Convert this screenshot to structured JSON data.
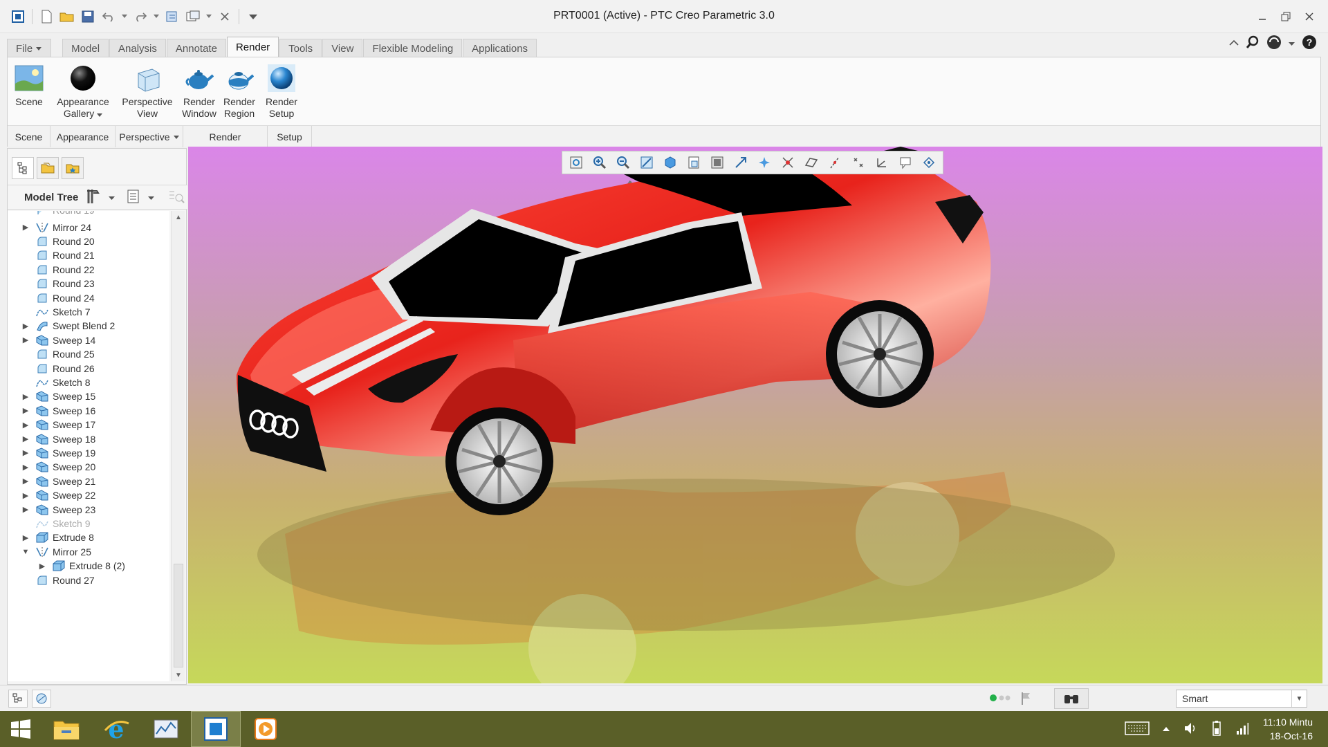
{
  "window": {
    "title": "PRT0001 (Active) - PTC Creo Parametric 3.0"
  },
  "tabs": [
    {
      "label": "File",
      "name": "tab-file"
    },
    {
      "label": "Model",
      "name": "tab-model"
    },
    {
      "label": "Analysis",
      "name": "tab-analysis"
    },
    {
      "label": "Annotate",
      "name": "tab-annotate"
    },
    {
      "label": "Render",
      "name": "tab-render",
      "active": true
    },
    {
      "label": "Tools",
      "name": "tab-tools"
    },
    {
      "label": "View",
      "name": "tab-view"
    },
    {
      "label": "Flexible Modeling",
      "name": "tab-flexible-modeling"
    },
    {
      "label": "Applications",
      "name": "tab-applications"
    }
  ],
  "ribbon": {
    "buttons": {
      "scene": "Scene",
      "appearance_1": "Appearance",
      "appearance_2": "Gallery",
      "perspective_1": "Perspective",
      "perspective_2": "View",
      "render_window_1": "Render",
      "render_window_2": "Window",
      "render_region_1": "Render",
      "render_region_2": "Region",
      "render_setup_1": "Render",
      "render_setup_2": "Setup"
    },
    "groups": {
      "scene": "Scene",
      "appearance": "Appearance",
      "perspective": "Perspective",
      "render": "Render",
      "setup": "Setup"
    }
  },
  "model_tree": {
    "label": "Model Tree",
    "items": [
      {
        "label": "Mirror 24",
        "icon": "mirror-icon",
        "expandable": true
      },
      {
        "label": "Round 20",
        "icon": "round-icon",
        "expandable": false
      },
      {
        "label": "Round 21",
        "icon": "round-icon",
        "expandable": false
      },
      {
        "label": "Round 22",
        "icon": "round-icon",
        "expandable": false
      },
      {
        "label": "Round 23",
        "icon": "round-icon",
        "expandable": false
      },
      {
        "label": "Round 24",
        "icon": "round-icon",
        "expandable": false
      },
      {
        "label": "Sketch 7",
        "icon": "sketch-icon",
        "expandable": false
      },
      {
        "label": "Swept Blend 2",
        "icon": "swept-blend-icon",
        "expandable": true
      },
      {
        "label": "Sweep 14",
        "icon": "sweep-icon",
        "expandable": true
      },
      {
        "label": "Round 25",
        "icon": "round-icon",
        "expandable": false
      },
      {
        "label": "Round 26",
        "icon": "round-icon",
        "expandable": false
      },
      {
        "label": "Sketch 8",
        "icon": "sketch-icon",
        "expandable": false
      },
      {
        "label": "Sweep 15",
        "icon": "sweep-icon",
        "expandable": true
      },
      {
        "label": "Sweep 16",
        "icon": "sweep-icon",
        "expandable": true
      },
      {
        "label": "Sweep 17",
        "icon": "sweep-icon",
        "expandable": true
      },
      {
        "label": "Sweep 18",
        "icon": "sweep-icon",
        "expandable": true
      },
      {
        "label": "Sweep 19",
        "icon": "sweep-icon",
        "expandable": true
      },
      {
        "label": "Sweep 20",
        "icon": "sweep-icon",
        "expandable": true
      },
      {
        "label": "Sweep 21",
        "icon": "sweep-icon",
        "expandable": true
      },
      {
        "label": "Sweep 22",
        "icon": "sweep-icon",
        "expandable": true
      },
      {
        "label": "Sweep 23",
        "icon": "sweep-icon",
        "expandable": true
      },
      {
        "label": "Sketch 9",
        "icon": "sketch-icon",
        "expandable": false,
        "dim": true
      },
      {
        "label": "Extrude 8",
        "icon": "extrude-icon",
        "expandable": true
      },
      {
        "label": "Mirror 25",
        "icon": "mirror-icon",
        "expandable": true,
        "expanded": true
      },
      {
        "label": "Extrude 8 (2)",
        "icon": "extrude-icon",
        "expandable": true,
        "child": true
      },
      {
        "label": "Round 27",
        "icon": "round-icon",
        "expandable": false
      }
    ]
  },
  "statusbar": {
    "selection_filter": "Smart"
  },
  "taskbar": {
    "time": "11:10 Mintu",
    "date": "18-Oct-16"
  },
  "colors": {
    "car_body": "#e8231c",
    "viewport_top": "#da86e8",
    "viewport_bottom": "#c6d85a",
    "taskbar": "#5a5f28"
  }
}
